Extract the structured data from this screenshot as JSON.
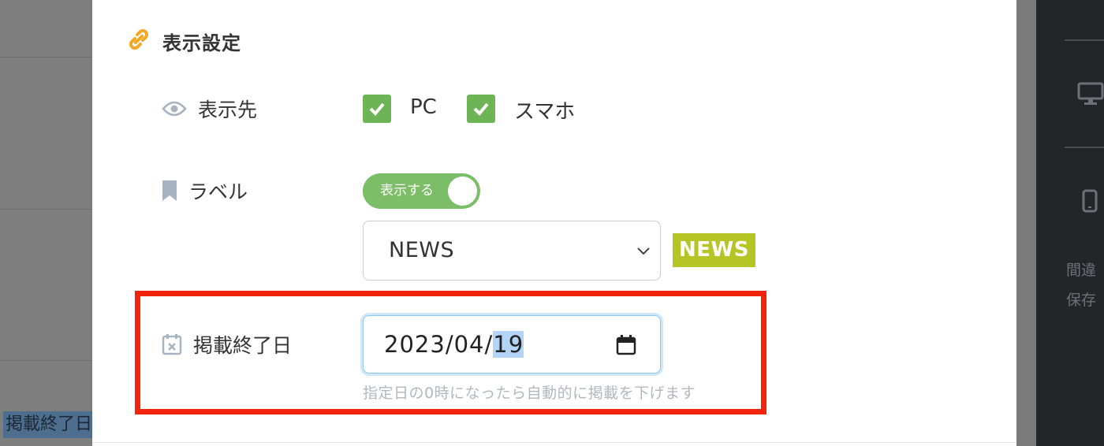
{
  "background": {
    "left_label": "掲載終了日",
    "right_panel_text": [
      "間違",
      "保存"
    ]
  },
  "section": {
    "title": "表示設定",
    "icon": "link-icon"
  },
  "display_target": {
    "label": "表示先",
    "icon": "eye-icon",
    "options": [
      {
        "label": "PC",
        "checked": true
      },
      {
        "label": "スマホ",
        "checked": true
      }
    ]
  },
  "label_row": {
    "label": "ラベル",
    "icon": "bookmark-icon",
    "toggle_text": "表示する",
    "toggle_on": true,
    "select_value": "NEWS",
    "badge_text": "NEWS",
    "badge_color": "#b5c526"
  },
  "end_date": {
    "label": "掲載終了日",
    "icon": "calendar-x-icon",
    "year": "2023",
    "month": "04",
    "day": "19",
    "sep": "/",
    "help": "指定日の0時になったら自動的に掲載を下げます"
  },
  "colors": {
    "accent_green": "#6cb456",
    "highlight_red": "#f2240b",
    "link_icon": "#f5a623"
  }
}
